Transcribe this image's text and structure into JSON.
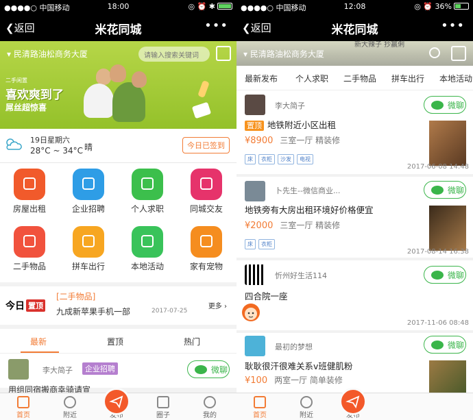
{
  "left": {
    "status": {
      "carrier": "●●●●○ 中国移动 ",
      "time": "18:00",
      "right": "◎ ⏰ ✱"
    },
    "nav": {
      "back": "❮返回",
      "title": "米花同城",
      "more": "•••"
    },
    "banner": {
      "location": "▾ 民清路油松商务大厦",
      "search_placeholder": "请输入搜索关键词",
      "small_text": "二手闲置",
      "headline": "喜欢爽到了",
      "subline": "屌丝超惊喜"
    },
    "weather": {
      "date": "19日星期六",
      "temp": "28°C ~ 34°C",
      "condition": "晴",
      "checkin": "今日已签到"
    },
    "grid": [
      {
        "label": "房屋出租",
        "color": "#f15a2b",
        "icon": "house-icon"
      },
      {
        "label": "企业招聘",
        "color": "#2e9de6",
        "icon": "clock-icon"
      },
      {
        "label": "个人求职",
        "color": "#3cbf4c",
        "icon": "id-card-icon"
      },
      {
        "label": "同城交友",
        "color": "#e6336b",
        "icon": "heart-pin-icon"
      },
      {
        "label": "二手物品",
        "color": "#f1523d",
        "icon": "basket-icon"
      },
      {
        "label": "拼车出行",
        "color": "#f7a621",
        "icon": "car-icon"
      },
      {
        "label": "本地活动",
        "color": "#39c35a",
        "icon": "balloon-icon"
      },
      {
        "label": "家有宠物",
        "color": "#f58d1f",
        "icon": "paw-icon"
      }
    ],
    "today": {
      "label": "今日",
      "badge": "置顶",
      "category": "[二手物品]",
      "title": "九成新苹果手机一部",
      "date": "2017-07-25",
      "more": "更多 ›"
    },
    "tabs": [
      "最新",
      "置顶",
      "热门"
    ],
    "preview": {
      "name": "李大简子",
      "badge": "企业招聘",
      "wechat": "微聊",
      "cut_text": "用组同宿搬商幸骑请宣"
    },
    "tabbar": [
      "首页",
      "附近",
      "发布",
      "圈子",
      "我的"
    ]
  },
  "right": {
    "status": {
      "carrier": "●●●●○ 中国移动 ",
      "time": "12:08",
      "right": "◎ ⏰ 36%"
    },
    "nav": {
      "back": "❮返回",
      "title": "米花同城",
      "more": "•••"
    },
    "banner_location": "▾ 民清路油松商务大厦",
    "banner_ghost": "新大辣子 抄赢俐",
    "chips": [
      "最新发布",
      "个人求职",
      "二手物品",
      "拼车出行",
      "本地活动"
    ],
    "cards": [
      {
        "name": "李大简子",
        "pin": "置顶",
        "title": "地铁附近小区出租",
        "price": "¥8900",
        "spec": "三室一厅  精装修",
        "tags": [
          "床",
          "衣柜",
          "沙发",
          "电视"
        ],
        "date": "2017-06-08 14:48",
        "wechat": "微聊"
      },
      {
        "name": "卜先生--微信商业...",
        "title": "地铁旁有大房出租环境好价格便宜",
        "price": "¥2000",
        "spec": "三室一厅  精装修",
        "tags": [
          "床",
          "衣柜"
        ],
        "date": "2017-08-14 16:38",
        "wechat": "微聊"
      },
      {
        "name": "忻州好生活114",
        "title": "四合院一座",
        "date": "2017-11-06 08:48",
        "wechat": "微聊"
      },
      {
        "name": "最初的梦想",
        "title": "耿耿很汗很难关系v班健肌粉",
        "price": "¥100",
        "spec": "两室一厅  简单装修",
        "wechat": "微聊"
      }
    ],
    "tabbar": [
      "首页",
      "附近",
      "发布"
    ]
  },
  "colors": {
    "accent": "#f27b34",
    "wechat": "#3ab54a",
    "banner_green": "#a6cc36"
  }
}
